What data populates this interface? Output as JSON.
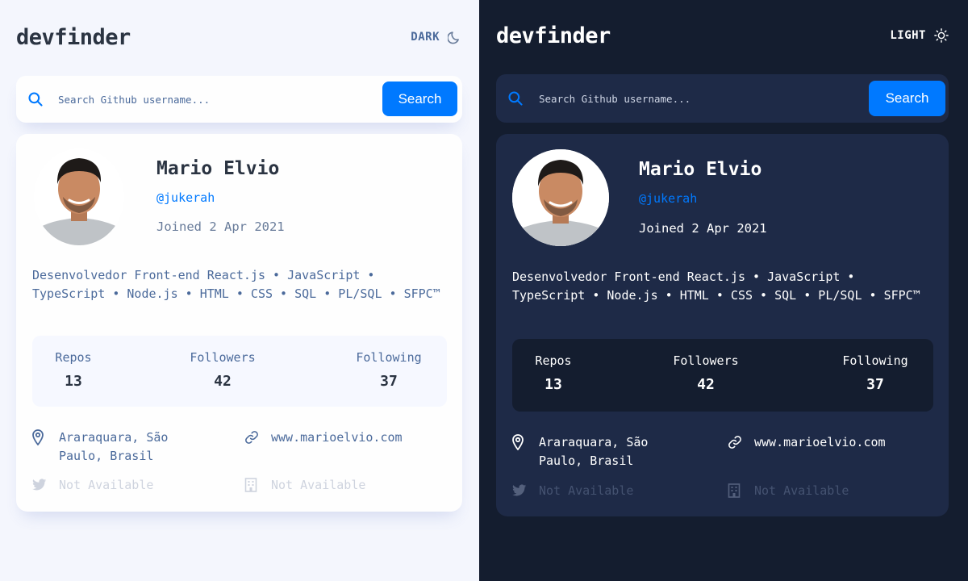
{
  "app": {
    "title": "devfinder"
  },
  "light": {
    "mode_label": "DARK",
    "search": {
      "placeholder": "Search Github username...",
      "button_label": "Search"
    },
    "profile": {
      "name": "Mario Elvio",
      "login": "@jukerah",
      "joined": "Joined 2 Apr 2021",
      "bio": "Desenvolvedor Front-end React.js • JavaScript • TypeScript • Node.js • HTML • CSS • SQL • PL/SQL • SFPC™",
      "stats": [
        {
          "label": "Repos",
          "value": "13"
        },
        {
          "label": "Followers",
          "value": "42"
        },
        {
          "label": "Following",
          "value": "37"
        }
      ],
      "links": {
        "location": "Araraquara, São\nPaulo, Brasil",
        "blog": "www.marioelvio.com",
        "twitter": "Not Available",
        "company": "Not Available"
      }
    }
  },
  "dark": {
    "mode_label": "LIGHT",
    "search": {
      "placeholder": "Search Github username...",
      "button_label": "Search"
    },
    "profile": {
      "name": "Mario Elvio",
      "login": "@jukerah",
      "joined": "Joined 2 Apr 2021",
      "bio": "Desenvolvedor Front-end React.js • JavaScript • TypeScript • Node.js • HTML • CSS • SQL • PL/SQL • SFPC™",
      "stats": [
        {
          "label": "Repos",
          "value": "13"
        },
        {
          "label": "Followers",
          "value": "42"
        },
        {
          "label": "Following",
          "value": "37"
        }
      ],
      "links": {
        "location": "Araraquara, São\nPaulo, Brasil",
        "blog": "www.marioelvio.com",
        "twitter": "Not Available",
        "company": "Not Available"
      }
    }
  },
  "colors": {
    "accent": "#0079ff",
    "light_bg": "#f4f6fd",
    "dark_bg": "#141d2f",
    "dark_card": "#1e2a47"
  }
}
